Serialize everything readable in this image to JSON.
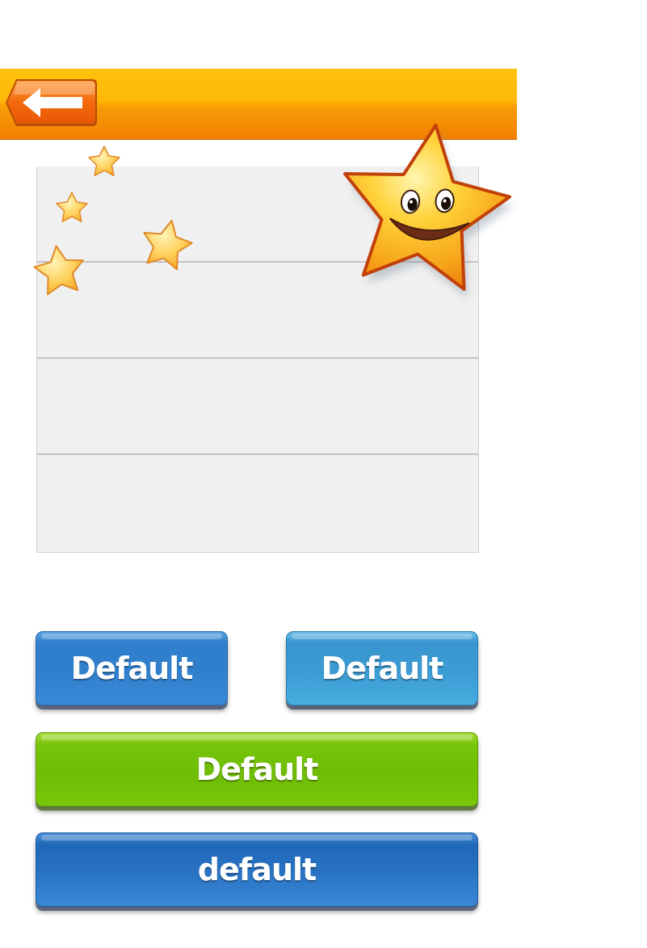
{
  "header": {
    "back_icon": "left-arrow-icon",
    "accent_color": "#f89a06"
  },
  "list": {
    "rows": [
      {
        "label": ""
      },
      {
        "label": ""
      },
      {
        "label": ""
      },
      {
        "label": ""
      }
    ]
  },
  "decorations": {
    "mascot": "smiling-star-icon",
    "small_stars": [
      "star-icon",
      "star-icon",
      "star-icon",
      "star-icon"
    ]
  },
  "buttons": {
    "primary_left": {
      "label": "Default",
      "color": "#2f7fcd"
    },
    "primary_right": {
      "label": "Default",
      "color": "#3b9bd3"
    },
    "success_wide": {
      "label": "Default",
      "color": "#6fbd05"
    },
    "wide_blue": {
      "label": "default",
      "color": "#2a73c4"
    }
  }
}
